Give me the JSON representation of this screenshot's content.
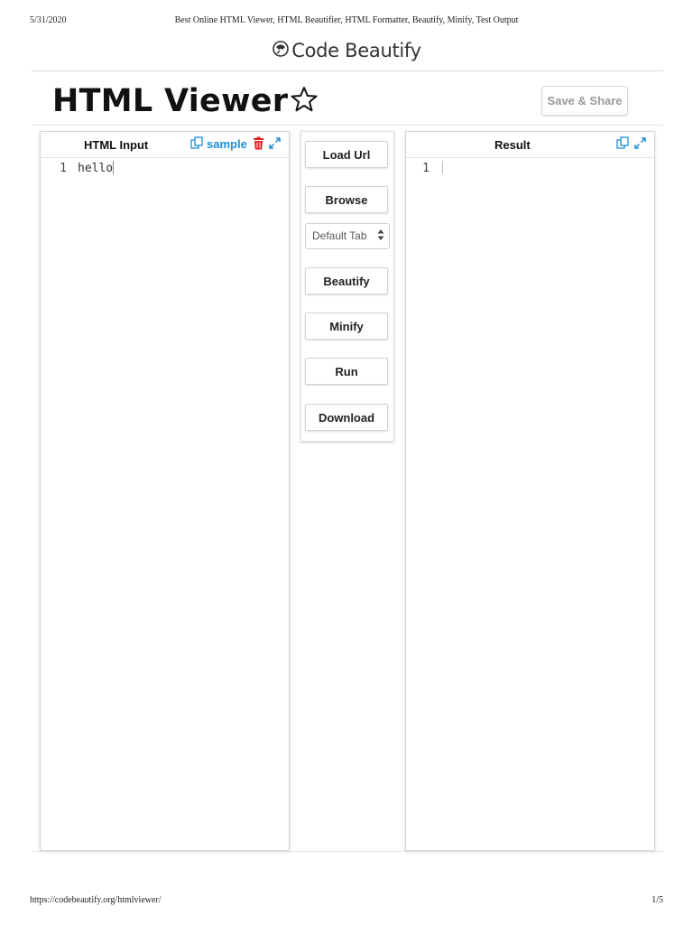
{
  "print_header": {
    "date": "5/31/2020",
    "title": "Best Online HTML Viewer, HTML Beautifier, HTML Formatter, Beautify, Minify, Test Output"
  },
  "brand": {
    "name": "Code Beautify"
  },
  "page": {
    "title": "HTML Viewer",
    "save_share_label": "Save & Share"
  },
  "input_panel": {
    "title": "HTML Input",
    "sample_label": "sample",
    "line_number": "1",
    "content": "hello"
  },
  "tools": {
    "load_url": "Load Url",
    "browse": "Browse",
    "tab_size": "Default Tab",
    "beautify": "Beautify",
    "minify": "Minify",
    "run": "Run",
    "download": "Download"
  },
  "result_panel": {
    "title": "Result",
    "line_number": "1",
    "content": ""
  },
  "print_footer": {
    "url": "https://codebeautify.org/htmlviewer/",
    "page": "1/5"
  },
  "colors": {
    "accent": "#1a8fd6",
    "danger": "#e02020",
    "muted_button_text": "#9a9a9a"
  },
  "icons": [
    "logo-icon",
    "star-icon",
    "copy-icon",
    "trash-icon",
    "expand-icon",
    "select-arrows-icon"
  ]
}
